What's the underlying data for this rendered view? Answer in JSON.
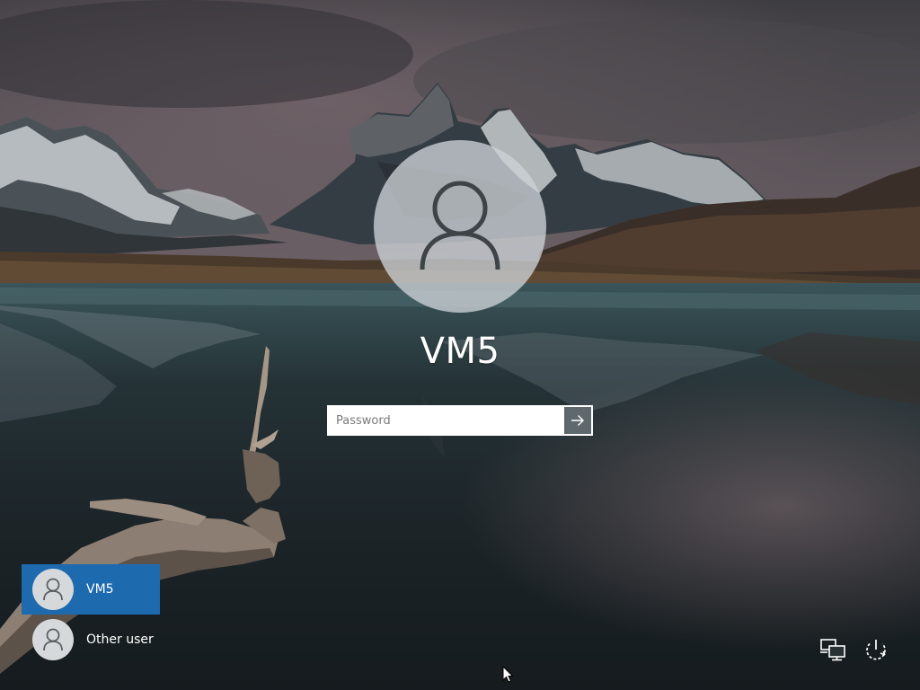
{
  "lock_screen": {
    "username": "VM5",
    "password_placeholder": "Password",
    "submit_icon": "arrow-right-icon",
    "avatar_icon": "user-silhouette-icon"
  },
  "user_list": [
    {
      "label": "VM5",
      "selected": true
    },
    {
      "label": "Other user",
      "selected": false
    }
  ],
  "corner_icons": [
    {
      "name": "network-icon"
    },
    {
      "name": "power-icon"
    }
  ],
  "colors": {
    "selected_user_bg": "#1e6aae",
    "submit_button_bg": "#5f686d"
  }
}
